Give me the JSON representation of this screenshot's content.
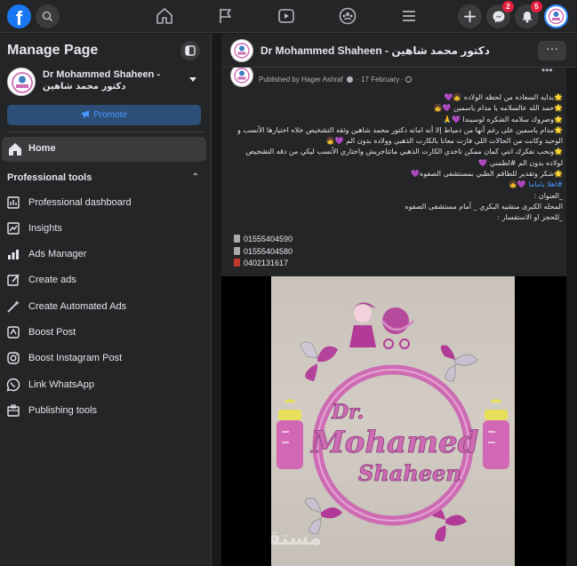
{
  "topbar": {
    "logo": "f",
    "icons": [
      "search-icon",
      "home-icon",
      "flag-icon",
      "watch-icon",
      "groups-icon",
      "menu-icon"
    ],
    "actions": {
      "create": "+",
      "messenger_badge": "2",
      "notifications_badge": "5"
    }
  },
  "sidebar": {
    "title": "Manage Page",
    "page_name": "Dr Mohammed Shaheen -",
    "page_name_ar": "دكتور محمد شاهين",
    "promote_label": "Promote",
    "home_label": "Home",
    "tools_heading": "Professional tools",
    "tools": [
      {
        "label": "Professional dashboard",
        "icon": "dashboard-icon"
      },
      {
        "label": "Insights",
        "icon": "insights-icon"
      },
      {
        "label": "Ads Manager",
        "icon": "ads-manager-icon"
      },
      {
        "label": "Create ads",
        "icon": "edit-icon"
      },
      {
        "label": "Create Automated Ads",
        "icon": "magic-wand-icon"
      },
      {
        "label": "Boost Post",
        "icon": "boost-icon"
      },
      {
        "label": "Boost Instagram Post",
        "icon": "instagram-icon"
      },
      {
        "label": "Link WhatsApp",
        "icon": "whatsapp-icon"
      },
      {
        "label": "Publishing tools",
        "icon": "publishing-icon"
      }
    ]
  },
  "main": {
    "header_title": "Dr Mohammed Shaheen - دكتور محمد شاهين",
    "post": {
      "author_cut": "Dr Mohammed Shaheen",
      "byline": "Published by Hager Ashraf",
      "date": "17 February",
      "lines": [
        "🌟بدايه السعاده من لحظه الولاده 👧💜",
        "🌟حمد الله عالسلامه يا مدام ياسمين 💜👧",
        "🌟وصروك سلامه الشكره لوسيندا 💜🙏",
        "🌟مدام ياسمين على رغم أنها من دمياط إلا أنه امانه دكتور محمد شاهين وثقه التشخيص خلاه اختيارها الأنسب و",
        "الوحيد وكانت من الحالات اللي فازت معانا بالكارت الذهبي وولاده بدون الم 💜👧",
        "🌟ونحب نفكرك انتي كمان ممكن تاخدي الكارت الذهبي ماتتاخريش واختاري الأنسب ليكي من دقه التشخيص",
        "لولاده بدون الم #لطمني 💜",
        "🌟شكر وتقدير للطاقم الطبي بمستشفى الصفوه💜"
      ],
      "hashtag_line": "#اهلا ياماما 💜👧",
      "address_lines": [
        "_العنوان :",
        "المحله الكبرى منشيه البكري _ أمام مستشفى الصفوه",
        "_للحجز او الاستفسار :"
      ],
      "phones": [
        "01555404590",
        "01555404580",
        "0402131617"
      ],
      "sign": {
        "line1": "Dr.",
        "line2": "Mohamed",
        "line3": "Shaheen"
      },
      "watermark": "مستقل"
    }
  },
  "colors": {
    "accent": "#1877f2",
    "panel": "#242526",
    "background": "#18191a",
    "sign_pink": "#cd6bb3"
  }
}
